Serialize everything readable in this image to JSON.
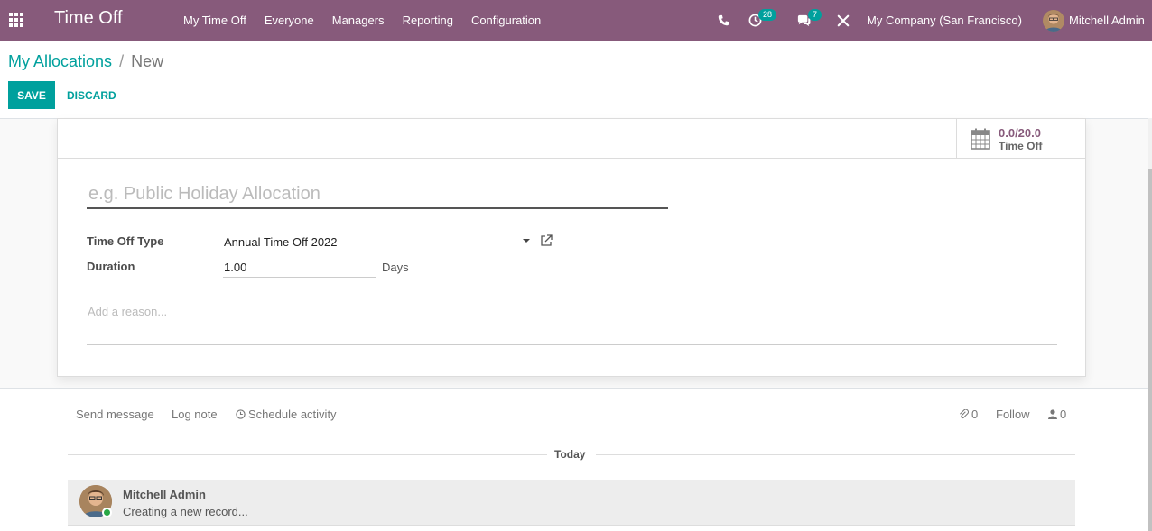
{
  "navbar": {
    "app_title": "Time Off",
    "menu": [
      "My Time Off",
      "Everyone",
      "Managers",
      "Reporting",
      "Configuration"
    ],
    "activity_count": "28",
    "message_count": "7",
    "company": "My Company (San Francisco)",
    "user": "Mitchell Admin",
    "bg_color": "#875a7b"
  },
  "breadcrumb": {
    "parent": "My Allocations",
    "separator": "/",
    "current": "New"
  },
  "actions": {
    "save": "SAVE",
    "discard": "DISCARD"
  },
  "stat_button": {
    "value": "0.0/20.0",
    "label": "Time Off"
  },
  "form": {
    "name_placeholder": "e.g. Public Holiday Allocation",
    "name_value": "",
    "time_off_type_label": "Time Off Type",
    "time_off_type_value": "Annual Time Off 2022",
    "duration_label": "Duration",
    "duration_value": "1.00",
    "duration_unit": "Days",
    "reason_placeholder": "Add a reason..."
  },
  "chatter": {
    "send_message": "Send message",
    "log_note": "Log note",
    "schedule_activity": "Schedule activity",
    "attachments_count": "0",
    "follow": "Follow",
    "followers_count": "0",
    "date_separator": "Today",
    "message_author": "Mitchell Admin",
    "message_body": "Creating a new record..."
  },
  "colors": {
    "accent": "#00a09d",
    "brand": "#875a7b"
  }
}
